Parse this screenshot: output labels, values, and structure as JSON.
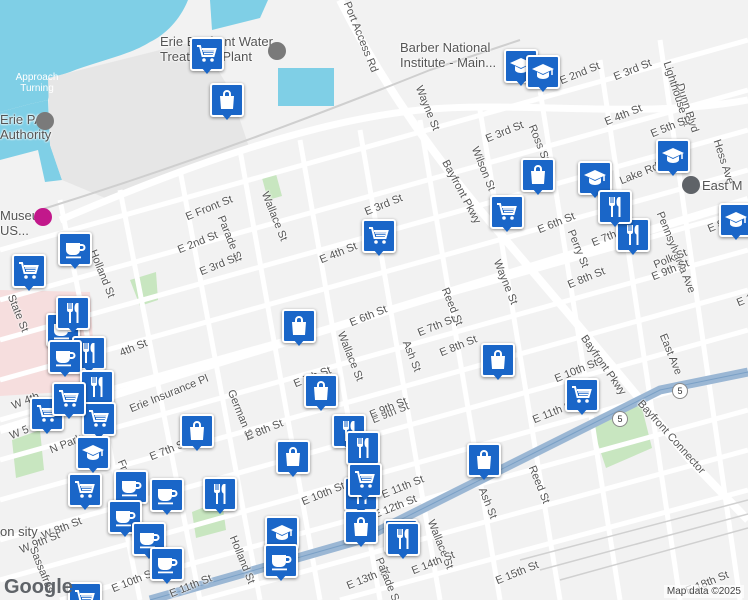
{
  "map": {
    "streets": [
      {
        "text": "Port Access Rd",
        "rot": 68
      },
      {
        "text": "Wayne St",
        "rot": 68
      },
      {
        "text": "Wilson St",
        "rot": 68
      },
      {
        "text": "Ross St",
        "rot": 68
      },
      {
        "text": "Dunn Blvd",
        "rot": 72
      },
      {
        "text": "Lighthouse St",
        "rot": 72
      },
      {
        "text": "Hess Ave",
        "rot": 72
      },
      {
        "text": "E 2nd St",
        "rot": -22
      },
      {
        "text": "E 3rd St",
        "rot": -22
      },
      {
        "text": "E 4th St",
        "rot": -22
      },
      {
        "text": "E 5th St",
        "rot": -22
      },
      {
        "text": "E 3rd St",
        "rot": -22
      },
      {
        "text": "Lake Rd",
        "rot": -22
      },
      {
        "text": "Bayfront Pkwy",
        "rot": 62
      },
      {
        "text": "E 6th St",
        "rot": -22
      },
      {
        "text": "E 7th St",
        "rot": -22
      },
      {
        "text": "E 8th St",
        "rot": -22
      },
      {
        "text": "Perry St",
        "rot": 68
      },
      {
        "text": "Pennsylvania Ave",
        "rot": 68
      },
      {
        "text": "Polk St",
        "rot": -22
      },
      {
        "text": "E 9th St",
        "rot": -22
      },
      {
        "text": "E 8th",
        "rot": -22
      },
      {
        "text": "E 11",
        "rot": -22
      },
      {
        "text": "E Front St",
        "rot": -22
      },
      {
        "text": "Wallace St",
        "rot": 68
      },
      {
        "text": "E 3rd St",
        "rot": -22
      },
      {
        "text": "Parade St",
        "rot": 68
      },
      {
        "text": "E 2nd St",
        "rot": -22
      },
      {
        "text": "E 4th St",
        "rot": -22
      },
      {
        "text": "E 3rd St",
        "rot": -22
      },
      {
        "text": "Holland St",
        "rot": 68
      },
      {
        "text": "E 6th St",
        "rot": -22
      },
      {
        "text": "Reed St",
        "rot": 68
      },
      {
        "text": "Wayne St",
        "rot": 68
      },
      {
        "text": "E 7th St",
        "rot": -22
      },
      {
        "text": "Ash St",
        "rot": 68
      },
      {
        "text": "E 8th St",
        "rot": -22
      },
      {
        "text": "Bayfront Pkwy",
        "rot": 55
      },
      {
        "text": "East Ave",
        "rot": 68
      },
      {
        "text": "E 10th St",
        "rot": -22
      },
      {
        "text": "Bayfront Connector",
        "rot": 48
      },
      {
        "text": "E 11th St",
        "rot": -22
      },
      {
        "text": "Erie Insurance Pl",
        "rot": -22
      },
      {
        "text": "German St",
        "rot": 68
      },
      {
        "text": "E 8th St",
        "rot": -22
      },
      {
        "text": "Wallace St",
        "rot": 68
      },
      {
        "text": "E 9th St",
        "rot": -22
      },
      {
        "text": "E 7th St",
        "rot": -22
      },
      {
        "text": "E 10th St",
        "rot": -22
      },
      {
        "text": "Reed St",
        "rot": 68
      },
      {
        "text": "Ash St",
        "rot": 68
      },
      {
        "text": "Wallace St",
        "rot": 68
      },
      {
        "text": "E 13th St",
        "rot": -22
      },
      {
        "text": "E 14th St",
        "rot": -22
      },
      {
        "text": "E 15th St",
        "rot": -22
      },
      {
        "text": "Parade St",
        "rot": 68
      },
      {
        "text": "Holland St",
        "rot": 68
      },
      {
        "text": "State St",
        "rot": 68
      },
      {
        "text": "W 4th",
        "rot": -22
      },
      {
        "text": "W 5",
        "rot": -22
      },
      {
        "text": "N Park",
        "rot": -22
      },
      {
        "text": "W 8th St",
        "rot": -22
      },
      {
        "text": "W 9th St",
        "rot": -22
      },
      {
        "text": "Sassafras",
        "rot": 68
      },
      {
        "text": "E 10th St",
        "rot": -22
      },
      {
        "text": "E 11th St",
        "rot": -22
      },
      {
        "text": "E 18th St",
        "rot": -22
      },
      {
        "text": "Fr",
        "rot": 68
      },
      {
        "text": "4th St",
        "rot": -22
      },
      {
        "text": "E 7th St",
        "rot": -22
      },
      {
        "text": "E 9th St",
        "rot": -22
      },
      {
        "text": "E 11th St",
        "rot": -22
      },
      {
        "text": "E 12th St",
        "rot": -22
      }
    ],
    "places": [
      {
        "text": "Erie Bayfront Water Treatment Plant"
      },
      {
        "text": "Barber National Institute - Main..."
      },
      {
        "text": "Approach Turning"
      },
      {
        "text": "Erie PA Authority"
      },
      {
        "text": "Museum US..."
      },
      {
        "text": "East M"
      },
      {
        "text": "on sity"
      }
    ],
    "route_shields": [
      "5",
      "5"
    ],
    "markers": [
      {
        "icon": "cart-icon"
      },
      {
        "icon": "bag-icon"
      },
      {
        "icon": "grad-cap-icon"
      },
      {
        "icon": "grad-cap-icon"
      },
      {
        "icon": "bag-icon"
      },
      {
        "icon": "cart-icon"
      },
      {
        "icon": "grad-cap-icon"
      },
      {
        "icon": "grad-cap-icon"
      },
      {
        "icon": "cart-icon"
      },
      {
        "icon": "cutlery-icon"
      },
      {
        "icon": "cutlery-icon"
      },
      {
        "icon": "grad-cap-icon"
      },
      {
        "icon": "cart-icon"
      },
      {
        "icon": "cup-icon"
      },
      {
        "icon": "cup-icon"
      },
      {
        "icon": "cutlery-icon"
      },
      {
        "icon": "cutlery-icon"
      },
      {
        "icon": "cup-icon"
      },
      {
        "icon": "cutlery-icon"
      },
      {
        "icon": "cart-icon"
      },
      {
        "icon": "bag-icon"
      },
      {
        "icon": "bag-icon"
      },
      {
        "icon": "bag-icon"
      },
      {
        "icon": "cart-icon"
      },
      {
        "icon": "cart-icon"
      },
      {
        "icon": "bag-icon"
      },
      {
        "icon": "grad-cap-icon"
      },
      {
        "icon": "cutlery-icon"
      },
      {
        "icon": "cutlery-icon"
      },
      {
        "icon": "cart-icon"
      },
      {
        "icon": "cutlery-icon"
      },
      {
        "icon": "bag-icon"
      },
      {
        "icon": "cutlery-icon"
      },
      {
        "icon": "cart-icon"
      },
      {
        "icon": "cup-icon"
      },
      {
        "icon": "cup-icon"
      },
      {
        "icon": "cutlery-icon"
      },
      {
        "icon": "grad-cap-icon"
      },
      {
        "icon": "cup-icon"
      },
      {
        "icon": "cup-icon"
      },
      {
        "icon": "cup-icon"
      },
      {
        "icon": "cup-icon"
      },
      {
        "icon": "bag-icon"
      },
      {
        "icon": "cutlery-icon"
      },
      {
        "icon": "bag-icon"
      },
      {
        "icon": "cart-icon"
      },
      {
        "icon": "cart-icon"
      }
    ],
    "footer": {
      "logo": "Google",
      "credit": "Map data ©2025"
    }
  },
  "colors": {
    "water": "#7fcfe6",
    "land": "#f2f2f2",
    "park": "#c8e6c0",
    "marker": "#1a66c8",
    "highway": "#9bb7d4"
  }
}
